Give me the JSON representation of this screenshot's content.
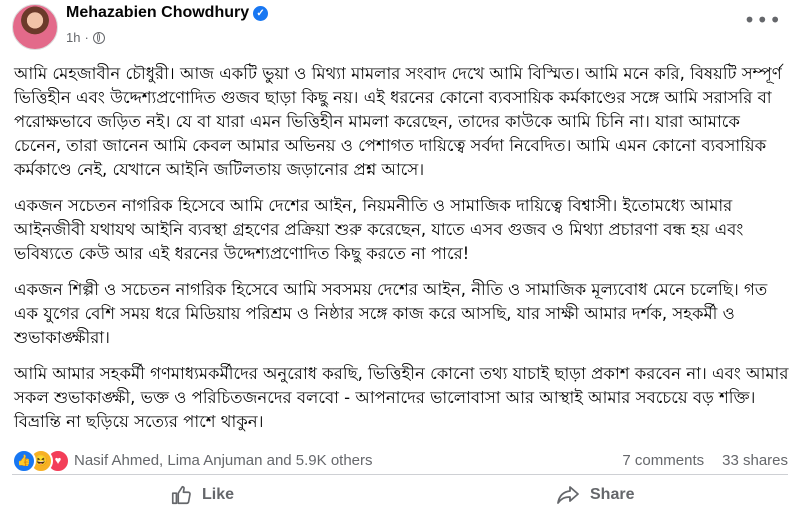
{
  "header": {
    "name": "Mehazabien Chowdhury",
    "time": "1h",
    "dot": "·",
    "more": "•••"
  },
  "post": {
    "paragraphs": [
      "আমি মেহজাবীন চৌধুরী। আজ একটি ভুয়া ও মিথ্যা মামলার সংবাদ দেখে আমি বিস্মিত। আমি মনে করি, বিষয়টি সম্পূর্ণ ভিত্তিহীন এবং উদ্দেশ্যপ্রণোদিত গুজব ছাড়া কিছু নয়। এই ধরনের কোনো ব্যবসায়িক কর্মকাণ্ডের সঙ্গে আমি সরাসরি বা পরোক্ষভাবে জড়িত নই। যে বা যারা এমন ভিত্তিহীন মামলা করেছেন, তাদের কাউকে আমি চিনি না। যারা আমাকে চেনেন, তারা জানেন আমি কেবল আমার অভিনয় ও পেশাগত দায়িত্বে সর্বদা নিবেদিত। আমি এমন কোনো ব্যবসায়িক কর্মকাণ্ডে নেই, যেখানে আইনি জটিলতায় জড়ানোর প্রশ্ন আসে।",
      "একজন সচেতন নাগরিক হিসেবে আমি দেশের আইন, নিয়মনীতি ও সামাজিক দায়িত্বে বিশ্বাসী। ইতোমধ্যে আমার আইনজীবী যথাযথ আইনি ব্যবস্থা গ্রহণের প্রক্রিয়া শুরু করেছেন, যাতে এসব গুজব ও মিথ্যা প্রচারণা বন্ধ হয় এবং ভবিষ্যতে কেউ আর এই ধরনের উদ্দেশ্যপ্রণোদিত কিছু করতে না পারে!",
      "একজন শিল্পী ও সচেতন নাগরিক হিসেবে আমি সবসময় দেশের আইন, নীতি ও সামাজিক মূল্যবোধ মেনে চলেছি। গত এক যুগের বেশি সময় ধরে মিডিয়ায় পরিশ্রম ও নিষ্ঠার সঙ্গে কাজ করে আসছি, যার সাক্ষী আমার দর্শক, সহকর্মী ও শুভাকাঙ্ক্ষীরা।",
      "আমি আমার সহকর্মী গণমাধ্যমকর্মীদের অনুরোধ করছি, ভিত্তিহীন কোনো তথ্য যাচাই ছাড়া প্রকাশ করবেন না। এবং আমার সকল শুভাকাঙ্ক্ষী, ভক্ত ও পরিচিতজনদের বলবো - আপনাদের ভালোবাসা আর আস্থাই আমার সবচেয়ে বড় শক্তি। বিভ্রান্তি না ছড়িয়ে সত্যের পাশে থাকুন।"
    ]
  },
  "stats": {
    "reactors": "Nasif Ahmed, Lima Anjuman and 5.9K others",
    "comments": "7 comments",
    "shares": "33 shares"
  },
  "actions": {
    "like": "Like",
    "share": "Share"
  },
  "colors": {
    "accent": "#1877f2",
    "secondary_text": "#65676b"
  }
}
